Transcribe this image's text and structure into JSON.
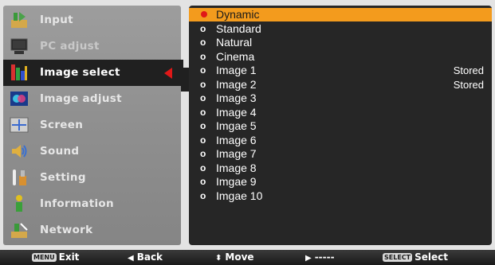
{
  "menu": [
    {
      "label": "Input",
      "icon": "input-icon",
      "state": "normal"
    },
    {
      "label": "PC adjust",
      "icon": "pc-adjust-icon",
      "state": "dim"
    },
    {
      "label": "Image select",
      "icon": "image-select-icon",
      "state": "active"
    },
    {
      "label": "Image adjust",
      "icon": "image-adjust-icon",
      "state": "normal"
    },
    {
      "label": "Screen",
      "icon": "screen-icon",
      "state": "normal"
    },
    {
      "label": "Sound",
      "icon": "sound-icon",
      "state": "normal"
    },
    {
      "label": "Setting",
      "icon": "setting-icon",
      "state": "normal"
    },
    {
      "label": "Information",
      "icon": "information-icon",
      "state": "normal"
    },
    {
      "label": "Network",
      "icon": "network-icon",
      "state": "normal"
    }
  ],
  "options": [
    {
      "label": "Dynamic",
      "selected": true,
      "status": ""
    },
    {
      "label": "Standard",
      "selected": false,
      "status": ""
    },
    {
      "label": "Natural",
      "selected": false,
      "status": ""
    },
    {
      "label": "Cinema",
      "selected": false,
      "status": ""
    },
    {
      "label": "Image 1",
      "selected": false,
      "status": "Stored"
    },
    {
      "label": "Image 2",
      "selected": false,
      "status": "Stored"
    },
    {
      "label": "Image 3",
      "selected": false,
      "status": ""
    },
    {
      "label": "Image 4",
      "selected": false,
      "status": ""
    },
    {
      "label": "Imgae 5",
      "selected": false,
      "status": ""
    },
    {
      "label": "Image 6",
      "selected": false,
      "status": ""
    },
    {
      "label": "Image 7",
      "selected": false,
      "status": ""
    },
    {
      "label": "Image 8",
      "selected": false,
      "status": ""
    },
    {
      "label": "Imgae 9",
      "selected": false,
      "status": ""
    },
    {
      "label": "Imgae 10",
      "selected": false,
      "status": ""
    }
  ],
  "option_bullet": "o",
  "bottom_bar": {
    "exit_key": "MENU",
    "exit_label": "Exit",
    "back_glyph": "◀",
    "back_label": "Back",
    "move_glyph": "⬍",
    "move_label": "Move",
    "next_glyph": "▶",
    "next_label": "-----",
    "select_key": "SELECT",
    "select_label": "Select"
  },
  "colors": {
    "selected_row": "#f39b1d",
    "active_arrow": "#e01818",
    "list_background": "#262626",
    "menu_background": "#8f8f8f"
  }
}
